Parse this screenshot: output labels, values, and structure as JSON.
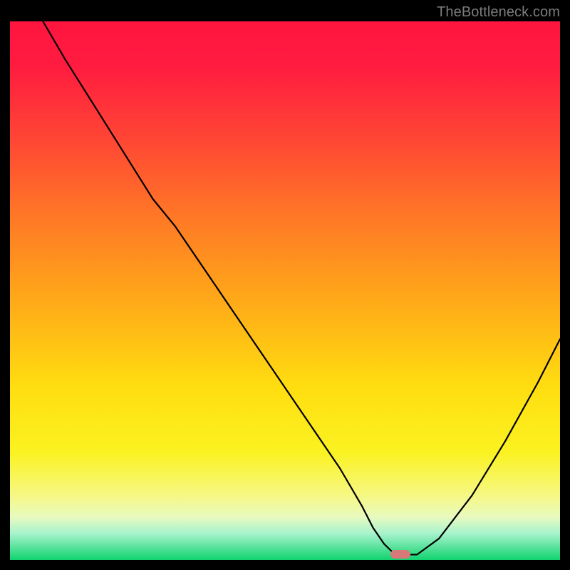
{
  "watermark": "TheBottleneck.com",
  "gradient_colors": {
    "top": "#ff153f",
    "mid1": "#ff7726",
    "mid2": "#ffde10",
    "low": "#f6f884",
    "bottom": "#10d36f"
  },
  "marker_color": "#d87878",
  "chart_data": {
    "type": "line",
    "title": "",
    "xlabel": "",
    "ylabel": "",
    "xlim": [
      0,
      100
    ],
    "ylim": [
      0,
      100
    ],
    "grid": false,
    "legend": false,
    "series": [
      {
        "name": "bottleneck-curve",
        "x": [
          6,
          10,
          18,
          26,
          30,
          34,
          40,
          46,
          52,
          56,
          60,
          64,
          66,
          68,
          70,
          74,
          78,
          84,
          90,
          96,
          100
        ],
        "values": [
          100,
          93,
          80,
          67,
          62,
          56,
          47,
          38,
          29,
          23,
          17,
          10,
          6,
          3,
          1,
          1,
          4,
          12,
          22,
          33,
          41
        ]
      }
    ],
    "annotations": [
      {
        "type": "marker",
        "x": 71,
        "y": 1,
        "shape": "pill",
        "color": "#d87878"
      }
    ]
  }
}
